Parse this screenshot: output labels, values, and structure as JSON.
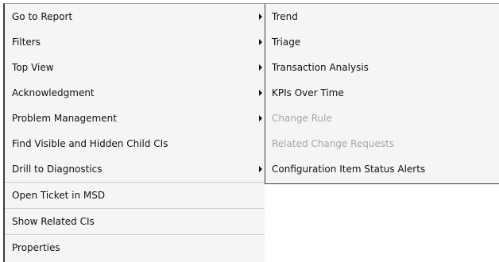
{
  "context_menu": {
    "items": [
      {
        "label": "Go to Report",
        "submenu": true
      },
      {
        "label": "Filters",
        "submenu": true
      },
      {
        "label": "Top View",
        "submenu": true
      },
      {
        "label": "Acknowledgment",
        "submenu": true
      },
      {
        "label": "Problem Management",
        "submenu": true
      },
      {
        "label": "Find Visible and Hidden Child CIs",
        "submenu": false
      },
      {
        "label": "Drill to Diagnostics",
        "submenu": true
      },
      {
        "label": "Open Ticket in MSD",
        "submenu": false
      },
      {
        "label": "Show Related CIs",
        "submenu": false
      },
      {
        "label": "Properties",
        "submenu": false
      }
    ]
  },
  "submenu": {
    "items": [
      {
        "label": "Trend",
        "enabled": true
      },
      {
        "label": "Triage",
        "enabled": true
      },
      {
        "label": "Transaction Analysis",
        "enabled": true
      },
      {
        "label": "KPIs Over Time",
        "enabled": true
      },
      {
        "label": "Change Rule",
        "enabled": false
      },
      {
        "label": "Related Change Requests",
        "enabled": false
      },
      {
        "label": "Configuration Item Status Alerts",
        "enabled": true
      }
    ]
  },
  "colors": {
    "menu_background": "#f5f5f5",
    "text": "#111111",
    "disabled_text": "#a6a6a6"
  },
  "icons": {
    "submenu_arrow": "triangle-right"
  }
}
